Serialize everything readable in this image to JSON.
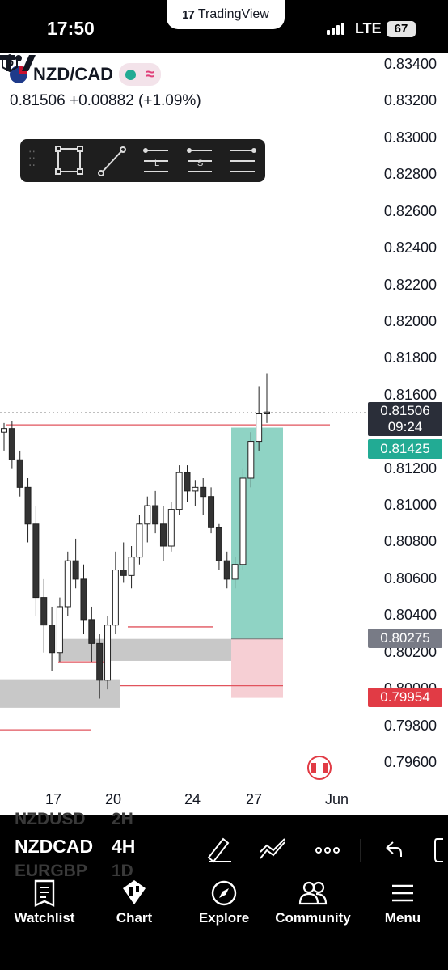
{
  "status": {
    "time": "17:50",
    "app_name": "TradingView",
    "network": "LTE",
    "battery": "67"
  },
  "symbol": {
    "name": "NZD/CAD",
    "price": "0.81506",
    "change": "+0.00882",
    "change_pct": "(+1.09%)"
  },
  "drawing_tools": [
    "rectangle-tool",
    "trend-line-tool",
    "long-position-tool",
    "short-position-tool",
    "horizontal-lines-tool"
  ],
  "drawing_tools_labels": {
    "long": "L",
    "short": "S"
  },
  "price_axis": [
    "0.83400",
    "0.83200",
    "0.83000",
    "0.82800",
    "0.82600",
    "0.82400",
    "0.82200",
    "0.82000",
    "0.81800",
    "0.81600",
    "0.81200",
    "0.81000",
    "0.80800",
    "0.80600",
    "0.80400",
    "0.80200",
    "0.80000",
    "0.79800",
    "0.79600"
  ],
  "time_axis": [
    "17",
    "20",
    "24",
    "27",
    "Jun"
  ],
  "price_labels": {
    "current": {
      "value": "0.81506",
      "countdown": "09:24",
      "color": "#2a2e39"
    },
    "target": {
      "value": "0.81425",
      "color": "#22ab94"
    },
    "entry": {
      "value": "0.80275",
      "color": "#787b86"
    },
    "stop": {
      "value": "0.79954",
      "color": "#e13b45"
    }
  },
  "chart_data": {
    "type": "candlestick",
    "timeframe": "4H",
    "x_ticks": [
      "17",
      "20",
      "24",
      "27",
      "Jun"
    ],
    "y_range": [
      0.7955,
      0.8345
    ],
    "last_price": 0.81506,
    "position": {
      "side": "long",
      "entry": 0.80275,
      "target": 0.81425,
      "stop": 0.79954
    },
    "zones": [
      {
        "kind": "supply-demand",
        "from": 0.80275,
        "to": 0.80155
      },
      {
        "kind": "supply-demand",
        "from": 0.80055,
        "to": 0.799
      }
    ],
    "levels": [
      0.8144,
      0.8034,
      0.8015,
      0.8002,
      0.7978
    ],
    "candles": [
      [
        0.814,
        0.8145,
        0.813,
        0.8142
      ],
      [
        0.8142,
        0.8146,
        0.812,
        0.8125
      ],
      [
        0.8125,
        0.813,
        0.8105,
        0.811
      ],
      [
        0.811,
        0.8115,
        0.808,
        0.809
      ],
      [
        0.809,
        0.81,
        0.804,
        0.805
      ],
      [
        0.805,
        0.806,
        0.802,
        0.8035
      ],
      [
        0.8035,
        0.8045,
        0.801,
        0.802
      ],
      [
        0.802,
        0.805,
        0.8015,
        0.8045
      ],
      [
        0.8045,
        0.8075,
        0.804,
        0.807
      ],
      [
        0.807,
        0.8082,
        0.8055,
        0.806
      ],
      [
        0.806,
        0.8068,
        0.803,
        0.8038
      ],
      [
        0.8038,
        0.8045,
        0.8015,
        0.8025
      ],
      [
        0.8025,
        0.803,
        0.7995,
        0.8005
      ],
      [
        0.8005,
        0.804,
        0.8,
        0.8035
      ],
      [
        0.8035,
        0.8075,
        0.803,
        0.8065
      ],
      [
        0.8065,
        0.808,
        0.8058,
        0.8062
      ],
      [
        0.8062,
        0.8078,
        0.8055,
        0.8072
      ],
      [
        0.8072,
        0.8095,
        0.8068,
        0.809
      ],
      [
        0.809,
        0.8105,
        0.808,
        0.81
      ],
      [
        0.81,
        0.8108,
        0.8085,
        0.809
      ],
      [
        0.809,
        0.81,
        0.807,
        0.8078
      ],
      [
        0.8078,
        0.8102,
        0.8075,
        0.8098
      ],
      [
        0.8098,
        0.8122,
        0.8095,
        0.8118
      ],
      [
        0.8118,
        0.8122,
        0.8102,
        0.8108
      ],
      [
        0.8108,
        0.8114,
        0.81,
        0.811
      ],
      [
        0.811,
        0.8115,
        0.8095,
        0.8105
      ],
      [
        0.8105,
        0.811,
        0.8085,
        0.8088
      ],
      [
        0.8088,
        0.809,
        0.8065,
        0.807
      ],
      [
        0.807,
        0.8075,
        0.8055,
        0.806
      ],
      [
        0.806,
        0.8072,
        0.8055,
        0.8068
      ],
      [
        0.8068,
        0.812,
        0.8065,
        0.8115
      ],
      [
        0.8115,
        0.814,
        0.811,
        0.8135
      ],
      [
        0.8135,
        0.8165,
        0.813,
        0.815
      ],
      [
        0.815,
        0.8172,
        0.8145,
        0.8151
      ]
    ]
  },
  "bottom": {
    "ghost_rows": [
      {
        "symbol": "NZDUSD",
        "interval": "2H"
      },
      {
        "symbol": "EURGBP",
        "interval": "1D"
      }
    ],
    "symbol": "NZDCAD",
    "interval": "4H",
    "nav": [
      {
        "label": "Watchlist",
        "icon": "watchlist-icon"
      },
      {
        "label": "Chart",
        "icon": "chart-icon"
      },
      {
        "label": "Explore",
        "icon": "compass-icon"
      },
      {
        "label": "Community",
        "icon": "community-icon"
      },
      {
        "label": "Menu",
        "icon": "menu-icon"
      }
    ]
  }
}
